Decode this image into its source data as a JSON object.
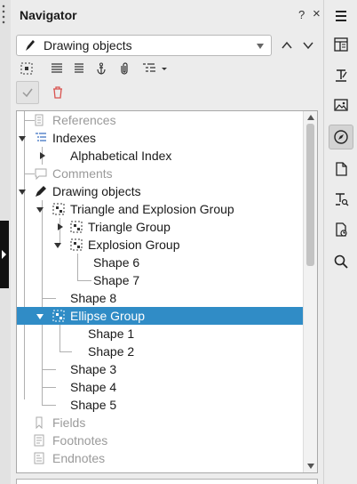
{
  "panel": {
    "title": "Navigator",
    "help_label": "?",
    "close_label": "×"
  },
  "dropdown": {
    "value": "Drawing objects"
  },
  "toolbar": {
    "icons": [
      "toggle-icon",
      "headings-promote-icon",
      "headings-demote-icon",
      "anchor-icon",
      "attach-icon",
      "heading-levels-icon"
    ]
  },
  "tree": {
    "items": [
      {
        "label": "References",
        "dim": true
      },
      {
        "label": "Indexes"
      },
      {
        "label": "Alphabetical Index"
      },
      {
        "label": "Comments",
        "dim": true
      },
      {
        "label": "Drawing objects"
      },
      {
        "label": "Triangle and Explosion Group"
      },
      {
        "label": "Triangle Group"
      },
      {
        "label": "Explosion Group"
      },
      {
        "label": "Shape 6"
      },
      {
        "label": "Shape 7"
      },
      {
        "label": "Shape 8"
      },
      {
        "label": "Ellipse Group",
        "selected": true
      },
      {
        "label": "Shape 1"
      },
      {
        "label": "Shape 2"
      },
      {
        "label": "Shape 3"
      },
      {
        "label": "Shape 4"
      },
      {
        "label": "Shape 5"
      },
      {
        "label": "Fields",
        "dim": true
      },
      {
        "label": "Footnotes",
        "dim": true
      },
      {
        "label": "Endnotes",
        "dim": true
      }
    ]
  },
  "colors": {
    "selection": "#308cc6",
    "delete_icon": "#d9534f"
  },
  "sidebar": {
    "icons": [
      "menu-icon",
      "properties-icon",
      "page-styles-icon",
      "gallery-icon",
      "navigator-icon",
      "page-icon",
      "style-inspector-icon",
      "manage-changes-icon",
      "find-icon"
    ],
    "active": "navigator-icon"
  }
}
